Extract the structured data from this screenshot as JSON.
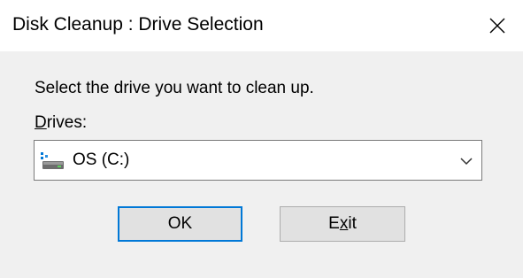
{
  "window": {
    "title": "Disk Cleanup : Drive Selection",
    "close_icon": "close-icon"
  },
  "main": {
    "prompt": "Select the drive you want to clean up.",
    "drives_label_accel": "D",
    "drives_label_rest": "rives:",
    "drive_select": {
      "selected": "OS (C:)",
      "icon": "hard-drive-icon"
    },
    "buttons": {
      "ok_label": "OK",
      "exit_label_pre": "E",
      "exit_label_accel": "x",
      "exit_label_post": "it"
    }
  },
  "colors": {
    "accent": "#0078d7",
    "dialog_bg": "#f0f0f0",
    "titlebar_bg": "#ffffff",
    "button_bg": "#e1e1e1"
  }
}
